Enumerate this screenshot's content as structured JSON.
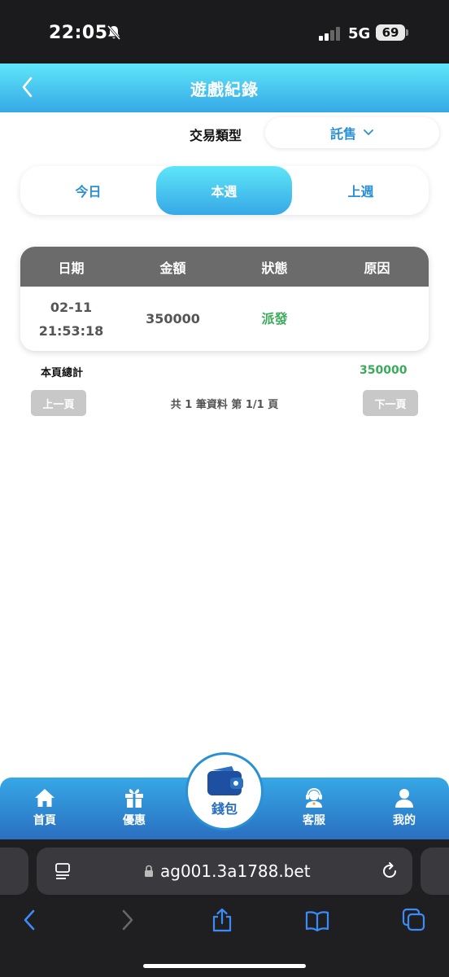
{
  "status_bar": {
    "time": "22:05",
    "network": "5G",
    "battery": "69"
  },
  "header": {
    "title": "遊戲紀錄"
  },
  "filter": {
    "label": "交易類型",
    "selected": "託售"
  },
  "tabs": [
    {
      "label": "今日",
      "active": false
    },
    {
      "label": "本週",
      "active": true
    },
    {
      "label": "上週",
      "active": false
    }
  ],
  "table": {
    "columns": [
      "日期",
      "金額",
      "狀態",
      "原因"
    ],
    "rows": [
      {
        "date": "02-11",
        "time": "21:53:18",
        "amount": "350000",
        "status": "派發",
        "reason": ""
      }
    ]
  },
  "summary": {
    "label": "本頁總計",
    "total": "350000"
  },
  "pagination": {
    "prev": "上一頁",
    "info": "共 1 筆資料 第 1/1 頁",
    "next": "下一頁"
  },
  "bottom_nav": {
    "items": [
      {
        "label": "首頁",
        "icon": "home-icon"
      },
      {
        "label": "優惠",
        "icon": "gift-icon"
      },
      {
        "label": "錢包",
        "icon": "wallet-icon"
      },
      {
        "label": "客服",
        "icon": "support-agent-icon"
      },
      {
        "label": "我的",
        "icon": "user-icon"
      }
    ]
  },
  "browser": {
    "url": "ag001.3a1788.bet"
  },
  "colors": {
    "accent": "#2a8fd4",
    "header_gradient_top": "#5ee6f9",
    "header_gradient_bottom": "#36a8e6",
    "status_green": "#3aaa5b",
    "table_header": "#6b6b6b"
  }
}
